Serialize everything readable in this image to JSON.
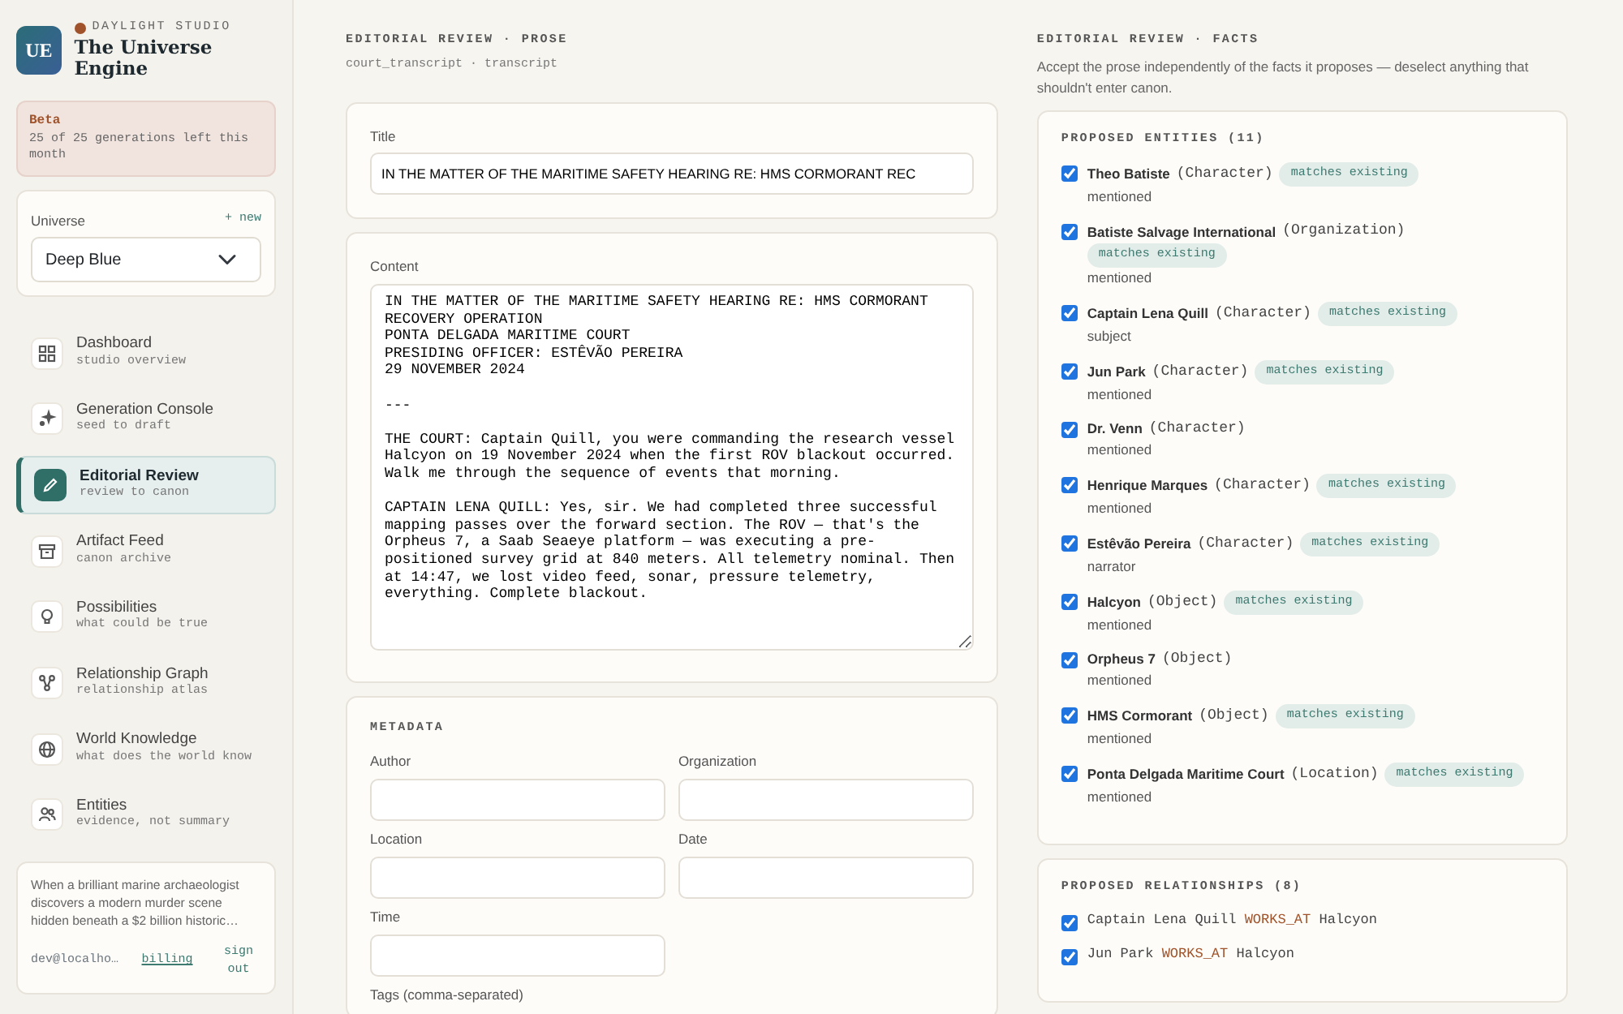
{
  "brand": {
    "studio": "DAYLIGHT STUDIO",
    "logo": "UE",
    "title": "The Universe Engine"
  },
  "plan": {
    "label": "Beta",
    "text": "25 of 25 generations left this month"
  },
  "universe": {
    "label": "Universe",
    "new_link": "+ new",
    "value": "Deep Blue"
  },
  "nav": [
    {
      "title": "Dashboard",
      "subtitle": "studio overview",
      "selected": false
    },
    {
      "title": "Generation Console",
      "subtitle": "seed to draft",
      "selected": false
    },
    {
      "title": "Editorial Review",
      "subtitle": "review to canon",
      "selected": true
    },
    {
      "title": "Artifact Feed",
      "subtitle": "canon archive",
      "selected": false
    },
    {
      "title": "Possibilities",
      "subtitle": "what could be true",
      "selected": false
    },
    {
      "title": "Relationship Graph",
      "subtitle": "relationship atlas",
      "selected": false
    },
    {
      "title": "World Knowledge",
      "subtitle": "what does the world know",
      "selected": false
    },
    {
      "title": "Entities",
      "subtitle": "evidence, not summary",
      "selected": false
    }
  ],
  "footer": {
    "blurb": "When a brilliant marine archaeologist discovers a modern murder scene hidden beneath a $2 billion historic…",
    "email": "dev@localho…",
    "billing": "billing",
    "sign_out": "sign out"
  },
  "prose": {
    "heading": "EDITORIAL REVIEW · PROSE",
    "subheading": "court_transcript · transcript",
    "title_label": "Title",
    "title_value": "IN THE MATTER OF THE MARITIME SAFETY HEARING RE: HMS CORMORANT REC",
    "content_label": "Content",
    "content_value": "IN THE MATTER OF THE MARITIME SAFETY HEARING RE: HMS CORMORANT RECOVERY OPERATION\nPONTA DELGADA MARITIME COURT\nPRESIDING OFFICER: ESTÊVÃO PEREIRA\n29 NOVEMBER 2024\n\n---\n\nTHE COURT: Captain Quill, you were commanding the research vessel Halcyon on 19 November 2024 when the first ROV blackout occurred. Walk me through the sequence of events that morning.\n\nCAPTAIN LENA QUILL: Yes, sir. We had completed three successful mapping passes over the forward section. The ROV — that's the Orpheus 7, a Saab Seaeye platform — was executing a pre-positioned survey grid at 840 meters. All telemetry nominal. Then at 14:47, we lost video feed, sonar, pressure telemetry, everything. Complete blackout.",
    "metadata_heading": "METADATA",
    "fields": [
      {
        "label": "Author"
      },
      {
        "label": "Organization"
      },
      {
        "label": "Location"
      },
      {
        "label": "Date"
      },
      {
        "label": "Time"
      }
    ],
    "tags_label": "Tags (comma-separated)"
  },
  "facts": {
    "heading": "EDITORIAL REVIEW · FACTS",
    "description": "Accept the prose independently of the facts it proposes — deselect anything that shouldn't enter canon.",
    "entities_heading": "PROPOSED ENTITIES (11)",
    "entities": [
      {
        "name": "Theo Batiste",
        "type": "(Character)",
        "badge": "matches existing",
        "role": "mentioned",
        "checked": true
      },
      {
        "name": "Batiste Salvage International",
        "type": "(Organization)",
        "badge": "matches existing",
        "role": "mentioned",
        "checked": true
      },
      {
        "name": "Captain Lena Quill",
        "type": "(Character)",
        "badge": "matches existing",
        "role": "subject",
        "checked": true
      },
      {
        "name": "Jun Park",
        "type": "(Character)",
        "badge": "matches existing",
        "role": "mentioned",
        "checked": true
      },
      {
        "name": "Dr. Venn",
        "type": "(Character)",
        "role": "mentioned",
        "checked": true
      },
      {
        "name": "Henrique Marques",
        "type": "(Character)",
        "badge": "matches existing",
        "role": "mentioned",
        "checked": true
      },
      {
        "name": "Estêvão Pereira",
        "type": "(Character)",
        "badge": "matches existing",
        "role": "narrator",
        "checked": true
      },
      {
        "name": "Halcyon",
        "type": "(Object)",
        "badge": "matches existing",
        "role": "mentioned",
        "checked": true
      },
      {
        "name": "Orpheus 7",
        "type": "(Object)",
        "role": "mentioned",
        "checked": true
      },
      {
        "name": "HMS Cormorant",
        "type": "(Object)",
        "badge": "matches existing",
        "role": "mentioned",
        "checked": true
      },
      {
        "name": "Ponta Delgada Maritime Court",
        "type": "(Location)",
        "badge": "matches existing",
        "role": "mentioned",
        "checked": true
      }
    ],
    "relationships_heading": "PROPOSED RELATIONSHIPS (8)",
    "relationships": [
      {
        "source": "Captain Lena Quill",
        "predicate": "WORKS_AT",
        "target": "Halcyon",
        "checked": true
      },
      {
        "source": "Jun Park",
        "predicate": "WORKS_AT",
        "target": "Halcyon",
        "checked": true
      }
    ]
  }
}
